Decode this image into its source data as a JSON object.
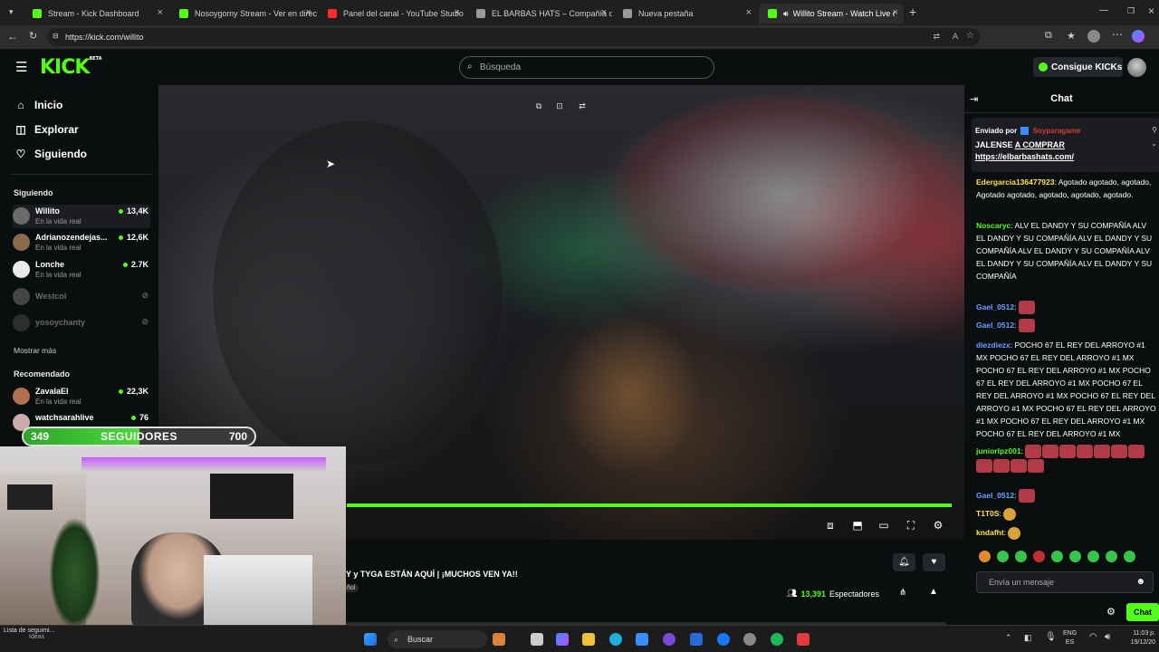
{
  "browser": {
    "tabs": [
      {
        "title": "Stream - Kick Dashboard",
        "color": "#53fc18"
      },
      {
        "title": "Nosoygomy Stream - Ver en direc",
        "color": "#53fc18"
      },
      {
        "title": "Panel del canal - YouTube Studio",
        "color": "#ff2b2b"
      },
      {
        "title": "EL BARBAS HATS – Compañía de s",
        "color": "#9a9a9a"
      },
      {
        "title": "Nueva pestaña",
        "color": "#9a9a9a"
      },
      {
        "title": "Willito Stream - Watch Live on",
        "color": "#53fc18"
      }
    ],
    "url": "https://kick.com/willito"
  },
  "header": {
    "logo": "KICK",
    "logo_beta": "BETA",
    "search_placeholder": "Búsqueda",
    "kicks_button": "Consigue KICKs"
  },
  "sidebar": {
    "nav": [
      {
        "label": "Inicio",
        "icon": "home-icon"
      },
      {
        "label": "Explorar",
        "icon": "compass-icon"
      },
      {
        "label": "Siguiendo",
        "icon": "heart-icon"
      }
    ],
    "following_header": "Siguiendo",
    "following": [
      {
        "name": "Willito",
        "status": "En la vida real",
        "viewers": "13,4K",
        "color": "#6b6b6b"
      },
      {
        "name": "Adrianozendejas...",
        "status": "En la vida real",
        "viewers": "12,6K",
        "color": "#8a6a4a"
      },
      {
        "name": "Lonche",
        "status": "En la vida real",
        "viewers": "2.7K",
        "color": "#eaeaea"
      },
      {
        "name": "Westcol",
        "status": "",
        "viewers": "",
        "color": "#888"
      },
      {
        "name": "yosoychanty",
        "status": "",
        "viewers": "",
        "color": "#555"
      }
    ],
    "show_more": "Mostrar más",
    "recommended_header": "Recomendado",
    "recommended": [
      {
        "name": "ZavalaEl",
        "status": "En la vida real",
        "viewers": "22,3K",
        "color": "#b07050"
      },
      {
        "name": "watchsarahlive",
        "status": "",
        "viewers": "76",
        "color": "#caa"
      }
    ]
  },
  "overlay": {
    "followers_current": "349",
    "followers_label": "SEGUIDORES",
    "followers_goal": "700",
    "progress": 0.5
  },
  "stream": {
    "title": "Y y TYGA ESTÁN AQUÍ | ¡MUCHOS VEN YA!!",
    "language": "ñol",
    "viewers_count": "13,391",
    "viewers_label": "Espectadores",
    "progress": 0.98
  },
  "chat": {
    "title": "Chat",
    "pinned_by_label": "Enviado por",
    "pinned_by_user": "Soyparagame",
    "pinned_message_prefix": "JALENSE",
    "pinned_message_link": "A COMPRAR",
    "pinned_url": "https://elbarbashats.com/",
    "messages": [
      {
        "user": "Edergarcia136477923",
        "user_color": "#ffe14d",
        "text": "Agotado agotado, agotado, Agotado agotado, agotado, agotado, agotado."
      },
      {
        "user": "Noscaryc",
        "user_color": "#53fc18",
        "text": "ALV EL DANDY Y SU COMPAÑÍA  ALV EL DANDY Y SU COMPAÑÍA  ALV EL DANDY Y SU COMPAÑÍA  ALV EL DANDY Y SU COMPAÑÍA  ALV EL DANDY Y SU COMPAÑÍA  ALV EL DANDY Y SU COMPAÑÍA"
      },
      {
        "user": "Gael_0512",
        "user_color": "#6aa0ff",
        "text": ""
      },
      {
        "user": "Gael_0512",
        "user_color": "#6aa0ff",
        "text": ""
      },
      {
        "user": "diezdiezx",
        "user_color": "#6aa0ff",
        "text": "POCHO 67 EL REY DEL ARROYO #1 MX POCHO 67 EL REY DEL ARROYO #1 MX POCHO 67 EL REY DEL ARROYO #1 MX POCHO 67 EL REY DEL ARROYO #1 MX POCHO 67 EL REY DEL ARROYO #1 MX POCHO 67 EL REY DEL ARROYO #1 MX POCHO 67 EL REY DEL ARROYO #1 MX POCHO 67 EL REY DEL ARROYO #1 MX POCHO 67 EL REY DEL ARROYO #1 MX"
      },
      {
        "user": "juniorlpz001",
        "user_color": "#53fc18",
        "text": ""
      },
      {
        "user": "Gael_0512",
        "user_color": "#6aa0ff",
        "text": ""
      },
      {
        "user": "T1T0S",
        "user_color": "#ffe14d",
        "text": ""
      },
      {
        "user": "kndafht",
        "user_color": "#ffe14d",
        "text": ""
      }
    ],
    "input_placeholder": "Envía un mensaje",
    "send_button": "Chat"
  },
  "taskbar": {
    "search": "Buscar",
    "lang": "ENG",
    "lang_sub": "ES",
    "time": "11:03 p.",
    "date": "19/12/20"
  },
  "bottom_notice": {
    "title": "Lista de seguimi...",
    "sub": "Ideas"
  }
}
